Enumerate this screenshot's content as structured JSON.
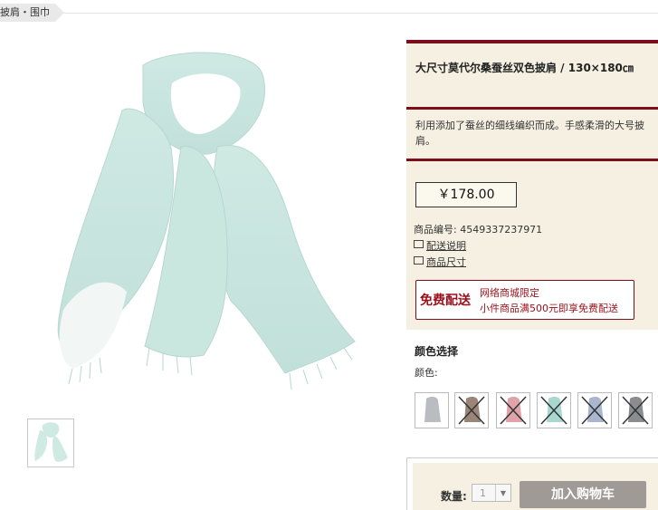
{
  "breadcrumb": {
    "text": "披肩・围巾"
  },
  "product": {
    "title": "大尺寸莫代尔桑蚕丝双色披肩 / 130×180㎝",
    "description": "利用添加了蚕丝的细线编织而成。手感柔滑的大号披肩。",
    "price": "￥178.00",
    "sku_text": "商品编号: 4549337237971",
    "shipping_link": "配送说明",
    "size_link": "商品尺寸"
  },
  "free_shipping": {
    "badge": "免费配送",
    "line1": "网络商城限定",
    "line2": "小件商品满500元即享免费配送"
  },
  "color_section": {
    "heading": "颜色选择",
    "label": "颜色:",
    "swatches": [
      {
        "name": "grey",
        "color": "#b9bcc0",
        "available": true
      },
      {
        "name": "brown",
        "color": "#9a8576",
        "available": false
      },
      {
        "name": "pink",
        "color": "#e0a3aa",
        "available": false
      },
      {
        "name": "mint",
        "color": "#a9d7cf",
        "available": false
      },
      {
        "name": "light-blue",
        "color": "#a9b6cd",
        "available": false
      },
      {
        "name": "dark-grey",
        "color": "#8a8c90",
        "available": false
      }
    ]
  },
  "cart": {
    "quantity_label": "数量:",
    "quantity_value": "1",
    "add_button": "加入购物车"
  },
  "colors": {
    "accent": "#7a0f1a",
    "panel_bg": "#f5f0e1",
    "scarf": "#cfe9e3"
  }
}
